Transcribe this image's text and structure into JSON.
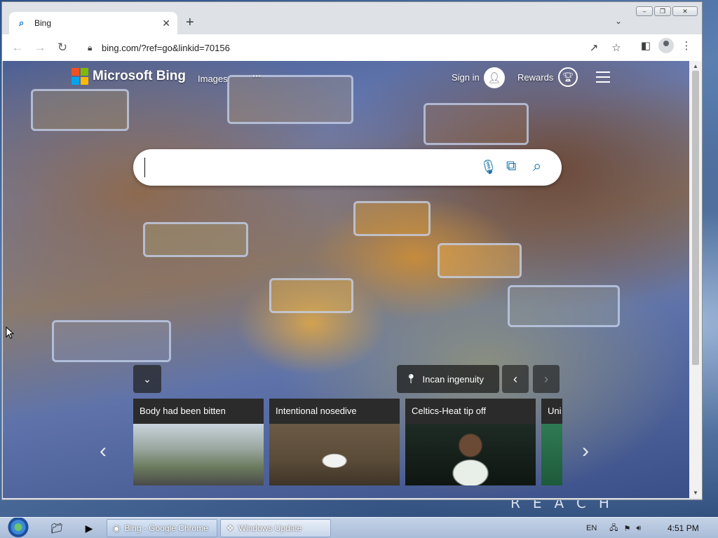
{
  "browser": {
    "tab_title": "Bing",
    "tab_favicon": "search-icon",
    "address": "bing.com/?ref=go&linkid=70156"
  },
  "bing": {
    "brand": "Microsoft Bing",
    "nav_images": "Images",
    "nav_more": "···",
    "sign_in": "Sign in",
    "rewards": "Rewards",
    "search_placeholder": "",
    "location_label": "Incan ingenuity",
    "cards": [
      {
        "caption": "Body had been bitten"
      },
      {
        "caption": "Intentional nosedive"
      },
      {
        "caption": "Celtics-Heat tip off"
      },
      {
        "caption": "Uni"
      }
    ]
  },
  "desktop": {
    "wallpaper_text": "REACH"
  },
  "taskbar": {
    "tasks": [
      {
        "label": "Bing - Google Chrome"
      },
      {
        "label": "Windows Update"
      }
    ],
    "language": "EN",
    "clock": "4:51 PM"
  },
  "colors": {
    "ms_red": "#f25022",
    "ms_green": "#7fba00",
    "ms_blue": "#00a4ef",
    "ms_yellow": "#ffb900",
    "bing_accent": "#1a73a8"
  }
}
